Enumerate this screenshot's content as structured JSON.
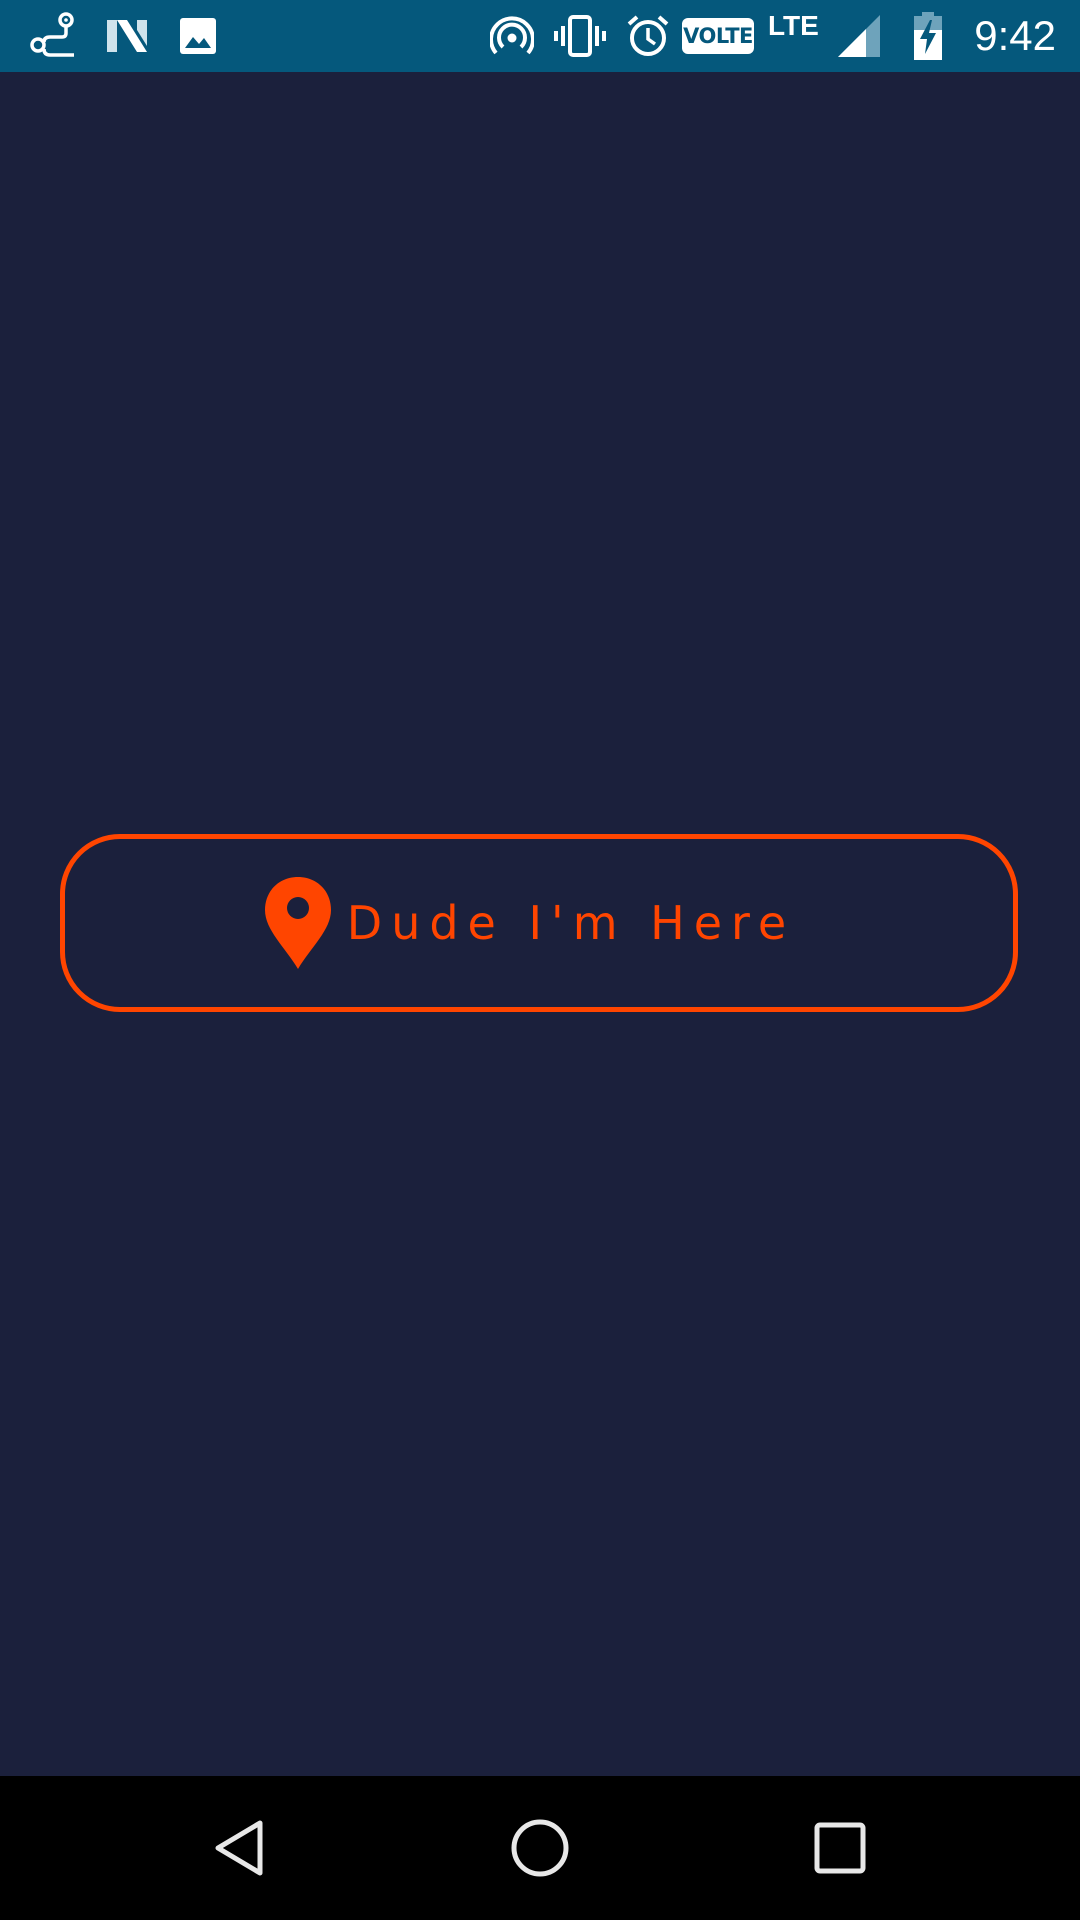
{
  "status_bar": {
    "time": "9:42",
    "volte": "VOLTE",
    "network": "LTE",
    "icons": [
      "route-icon",
      "n-logo-icon",
      "image-icon",
      "hotspot-icon",
      "vibrate-icon",
      "alarm-icon",
      "signal-icon",
      "battery-charging-icon"
    ]
  },
  "main": {
    "button_label": "Dude I'm Here",
    "button_icon": "location-pin-icon"
  },
  "nav_bar": {
    "icons": [
      "back-icon",
      "home-icon",
      "recents-icon"
    ]
  },
  "colors": {
    "background": "#1b203c",
    "status_bar": "#05587c",
    "accent": "#ff4500",
    "nav_bar": "#000000"
  }
}
